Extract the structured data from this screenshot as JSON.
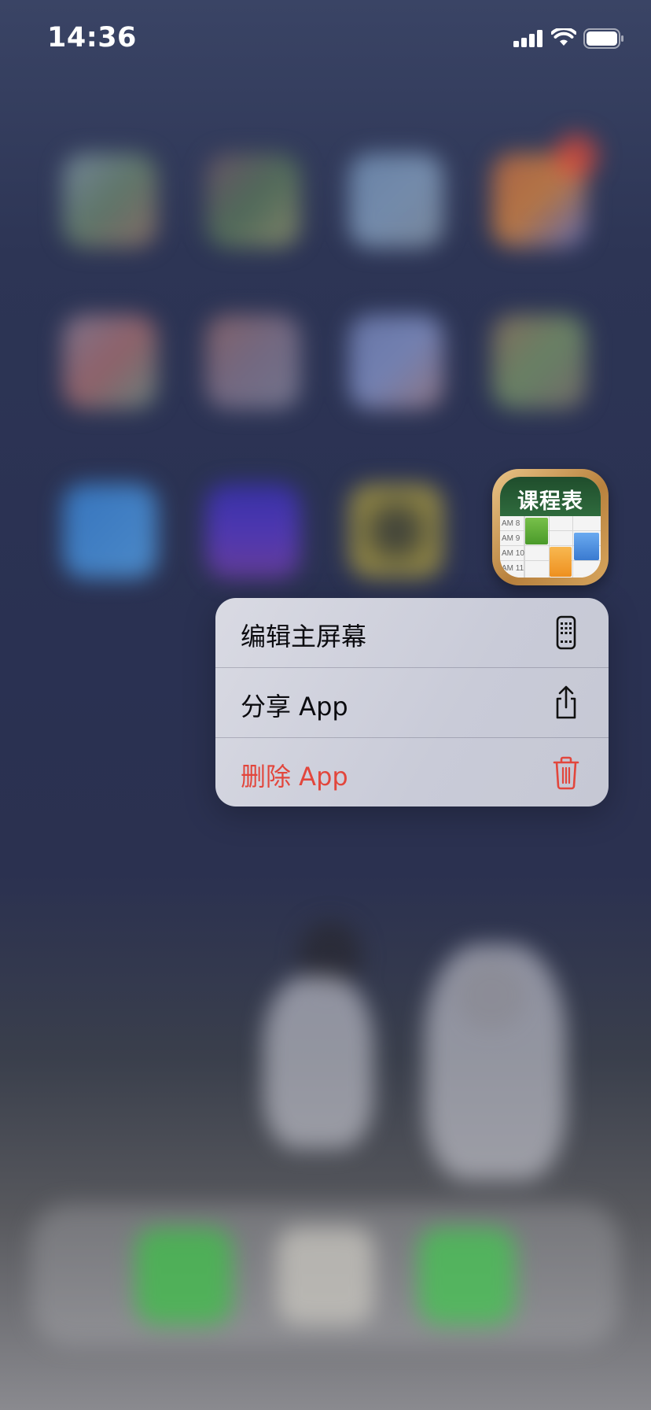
{
  "status_bar": {
    "time": "14:36",
    "icons": [
      "cellular-signal-icon",
      "wifi-icon",
      "battery-icon"
    ]
  },
  "focused_app": {
    "title_text": "课程表",
    "row_labels": [
      "AM 8",
      "AM 9",
      "AM 10",
      "AM 11"
    ],
    "icon_colors": {
      "frame": "#c89552",
      "board": "#2f6b3d",
      "green": "#5fa83a",
      "orange": "#f3a13a",
      "blue": "#4a8fd8"
    }
  },
  "context_menu": {
    "items": [
      {
        "label": "编辑主屏幕",
        "icon": "phone-home-screen-icon",
        "destructive": false
      },
      {
        "label": "分享 App",
        "icon": "share-icon",
        "destructive": false
      },
      {
        "label": "删除 App",
        "icon": "trash-icon",
        "destructive": true
      }
    ],
    "destructive_color": "#e2463c"
  }
}
